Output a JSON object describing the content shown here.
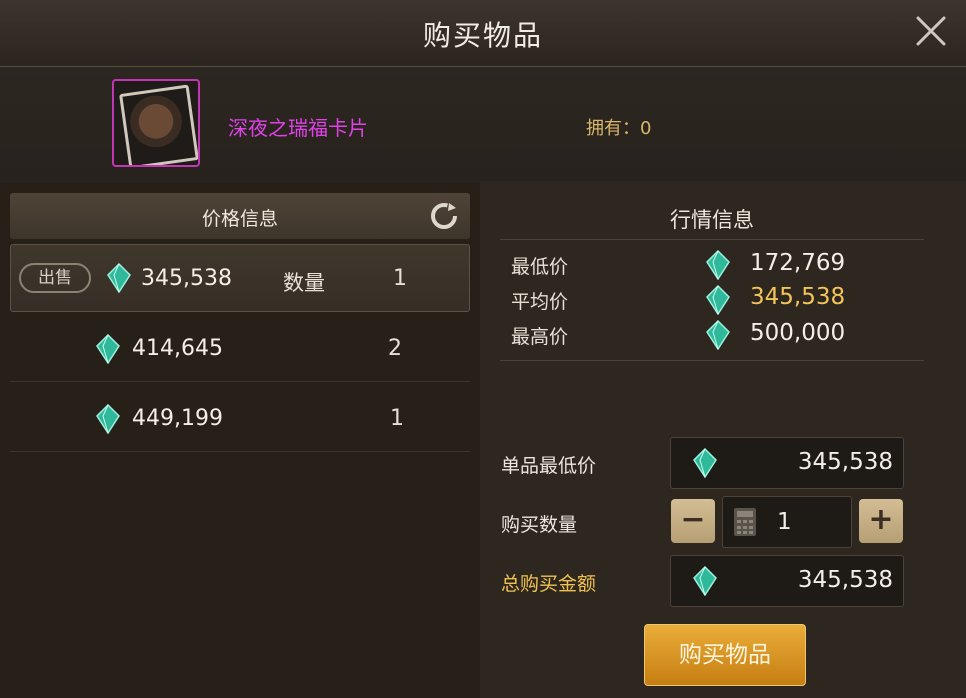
{
  "window": {
    "title": "购买物品"
  },
  "item": {
    "name": "深夜之瑞福卡片",
    "owned_label": "拥有：0"
  },
  "price_panel": {
    "header": "价格信息",
    "listings": [
      {
        "badge": "出售",
        "price": "345,538",
        "qty_label": "数量",
        "qty": "1"
      },
      {
        "price": "414,645",
        "qty": "2"
      },
      {
        "price": "449,199",
        "qty": "1"
      }
    ]
  },
  "market": {
    "title": "行情信息",
    "rows": [
      {
        "label": "最低价",
        "value": "172,769"
      },
      {
        "label": "平均价",
        "value": "345,538"
      },
      {
        "label": "最高价",
        "value": "500,000"
      }
    ]
  },
  "purchase": {
    "unit_label": "单品最低价",
    "unit_price": "345,538",
    "qty_label": "购买数量",
    "qty": "1",
    "minus": "−",
    "plus": "+",
    "total_label": "总购买金额",
    "total": "345,538",
    "buy_button": "购买物品"
  },
  "colors": {
    "accent": "#e9ad38",
    "item_name": "#e042e8",
    "average": "#f3c45a",
    "currency": "#3fc8a8"
  },
  "icons": [
    "close-icon",
    "refresh-icon",
    "gem-icon",
    "calculator-icon"
  ]
}
